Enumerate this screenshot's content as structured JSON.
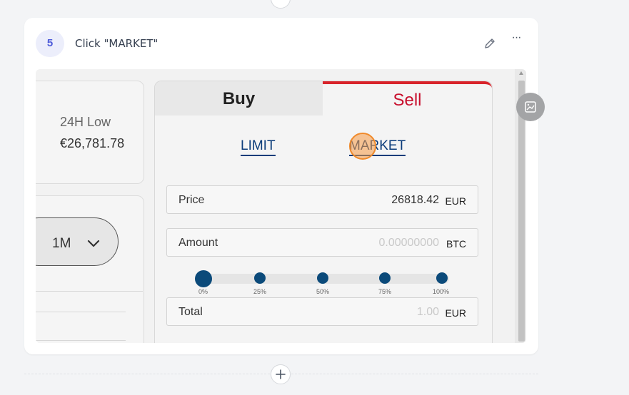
{
  "step": {
    "number": "5",
    "title": "Click \"MARKET\""
  },
  "toolbar": {
    "edit_icon": "pencil-icon",
    "more_icon": "more-horizontal-icon",
    "more_label": "···"
  },
  "screenshot": {
    "stats": {
      "low_label": "24H Low",
      "low_value": "€26,781.78"
    },
    "period": {
      "label": "1M"
    },
    "trade": {
      "tabs": {
        "buy": "Buy",
        "sell": "Sell"
      },
      "order_types": {
        "limit": "LIMIT",
        "market": "MARKET"
      },
      "price": {
        "label": "Price",
        "value": "26818.42",
        "unit": "EUR"
      },
      "amount": {
        "label": "Amount",
        "placeholder": "0.00000000",
        "unit": "BTC"
      },
      "slider": {
        "ticks": [
          "0%",
          "25%",
          "50%",
          "75%",
          "100%"
        ],
        "value_percent": 0
      },
      "total": {
        "label": "Total",
        "placeholder": "1.00",
        "unit": "EUR"
      }
    }
  },
  "colors": {
    "accent": "#4d5bd9",
    "sell_red": "#c8102e",
    "link_blue": "#0b3c7a",
    "click_marker": "#f08a2b"
  }
}
